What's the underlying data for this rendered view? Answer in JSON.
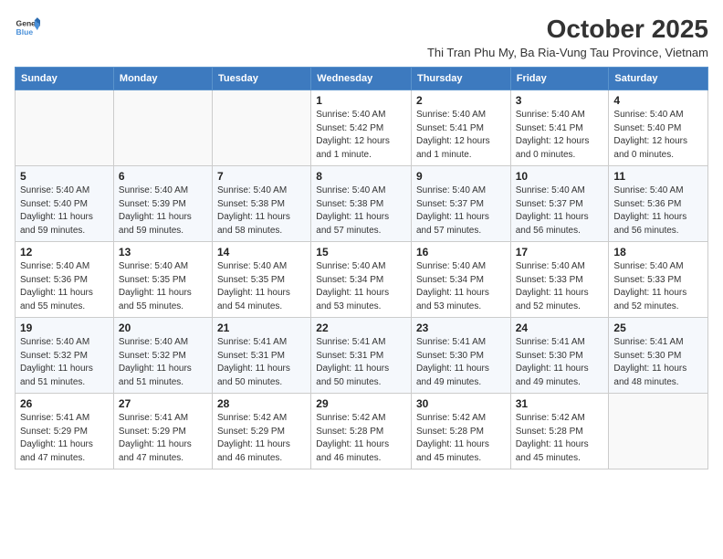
{
  "logo": {
    "line1": "General",
    "line2": "Blue"
  },
  "title": "October 2025",
  "subtitle": "Thi Tran Phu My, Ba Ria-Vung Tau Province, Vietnam",
  "days_of_week": [
    "Sunday",
    "Monday",
    "Tuesday",
    "Wednesday",
    "Thursday",
    "Friday",
    "Saturday"
  ],
  "weeks": [
    [
      {
        "day": "",
        "info": ""
      },
      {
        "day": "",
        "info": ""
      },
      {
        "day": "",
        "info": ""
      },
      {
        "day": "1",
        "info": "Sunrise: 5:40 AM\nSunset: 5:42 PM\nDaylight: 12 hours\nand 1 minute."
      },
      {
        "day": "2",
        "info": "Sunrise: 5:40 AM\nSunset: 5:41 PM\nDaylight: 12 hours\nand 1 minute."
      },
      {
        "day": "3",
        "info": "Sunrise: 5:40 AM\nSunset: 5:41 PM\nDaylight: 12 hours\nand 0 minutes."
      },
      {
        "day": "4",
        "info": "Sunrise: 5:40 AM\nSunset: 5:40 PM\nDaylight: 12 hours\nand 0 minutes."
      }
    ],
    [
      {
        "day": "5",
        "info": "Sunrise: 5:40 AM\nSunset: 5:40 PM\nDaylight: 11 hours\nand 59 minutes."
      },
      {
        "day": "6",
        "info": "Sunrise: 5:40 AM\nSunset: 5:39 PM\nDaylight: 11 hours\nand 59 minutes."
      },
      {
        "day": "7",
        "info": "Sunrise: 5:40 AM\nSunset: 5:38 PM\nDaylight: 11 hours\nand 58 minutes."
      },
      {
        "day": "8",
        "info": "Sunrise: 5:40 AM\nSunset: 5:38 PM\nDaylight: 11 hours\nand 57 minutes."
      },
      {
        "day": "9",
        "info": "Sunrise: 5:40 AM\nSunset: 5:37 PM\nDaylight: 11 hours\nand 57 minutes."
      },
      {
        "day": "10",
        "info": "Sunrise: 5:40 AM\nSunset: 5:37 PM\nDaylight: 11 hours\nand 56 minutes."
      },
      {
        "day": "11",
        "info": "Sunrise: 5:40 AM\nSunset: 5:36 PM\nDaylight: 11 hours\nand 56 minutes."
      }
    ],
    [
      {
        "day": "12",
        "info": "Sunrise: 5:40 AM\nSunset: 5:36 PM\nDaylight: 11 hours\nand 55 minutes."
      },
      {
        "day": "13",
        "info": "Sunrise: 5:40 AM\nSunset: 5:35 PM\nDaylight: 11 hours\nand 55 minutes."
      },
      {
        "day": "14",
        "info": "Sunrise: 5:40 AM\nSunset: 5:35 PM\nDaylight: 11 hours\nand 54 minutes."
      },
      {
        "day": "15",
        "info": "Sunrise: 5:40 AM\nSunset: 5:34 PM\nDaylight: 11 hours\nand 53 minutes."
      },
      {
        "day": "16",
        "info": "Sunrise: 5:40 AM\nSunset: 5:34 PM\nDaylight: 11 hours\nand 53 minutes."
      },
      {
        "day": "17",
        "info": "Sunrise: 5:40 AM\nSunset: 5:33 PM\nDaylight: 11 hours\nand 52 minutes."
      },
      {
        "day": "18",
        "info": "Sunrise: 5:40 AM\nSunset: 5:33 PM\nDaylight: 11 hours\nand 52 minutes."
      }
    ],
    [
      {
        "day": "19",
        "info": "Sunrise: 5:40 AM\nSunset: 5:32 PM\nDaylight: 11 hours\nand 51 minutes."
      },
      {
        "day": "20",
        "info": "Sunrise: 5:40 AM\nSunset: 5:32 PM\nDaylight: 11 hours\nand 51 minutes."
      },
      {
        "day": "21",
        "info": "Sunrise: 5:41 AM\nSunset: 5:31 PM\nDaylight: 11 hours\nand 50 minutes."
      },
      {
        "day": "22",
        "info": "Sunrise: 5:41 AM\nSunset: 5:31 PM\nDaylight: 11 hours\nand 50 minutes."
      },
      {
        "day": "23",
        "info": "Sunrise: 5:41 AM\nSunset: 5:30 PM\nDaylight: 11 hours\nand 49 minutes."
      },
      {
        "day": "24",
        "info": "Sunrise: 5:41 AM\nSunset: 5:30 PM\nDaylight: 11 hours\nand 49 minutes."
      },
      {
        "day": "25",
        "info": "Sunrise: 5:41 AM\nSunset: 5:30 PM\nDaylight: 11 hours\nand 48 minutes."
      }
    ],
    [
      {
        "day": "26",
        "info": "Sunrise: 5:41 AM\nSunset: 5:29 PM\nDaylight: 11 hours\nand 47 minutes."
      },
      {
        "day": "27",
        "info": "Sunrise: 5:41 AM\nSunset: 5:29 PM\nDaylight: 11 hours\nand 47 minutes."
      },
      {
        "day": "28",
        "info": "Sunrise: 5:42 AM\nSunset: 5:29 PM\nDaylight: 11 hours\nand 46 minutes."
      },
      {
        "day": "29",
        "info": "Sunrise: 5:42 AM\nSunset: 5:28 PM\nDaylight: 11 hours\nand 46 minutes."
      },
      {
        "day": "30",
        "info": "Sunrise: 5:42 AM\nSunset: 5:28 PM\nDaylight: 11 hours\nand 45 minutes."
      },
      {
        "day": "31",
        "info": "Sunrise: 5:42 AM\nSunset: 5:28 PM\nDaylight: 11 hours\nand 45 minutes."
      },
      {
        "day": "",
        "info": ""
      }
    ]
  ]
}
